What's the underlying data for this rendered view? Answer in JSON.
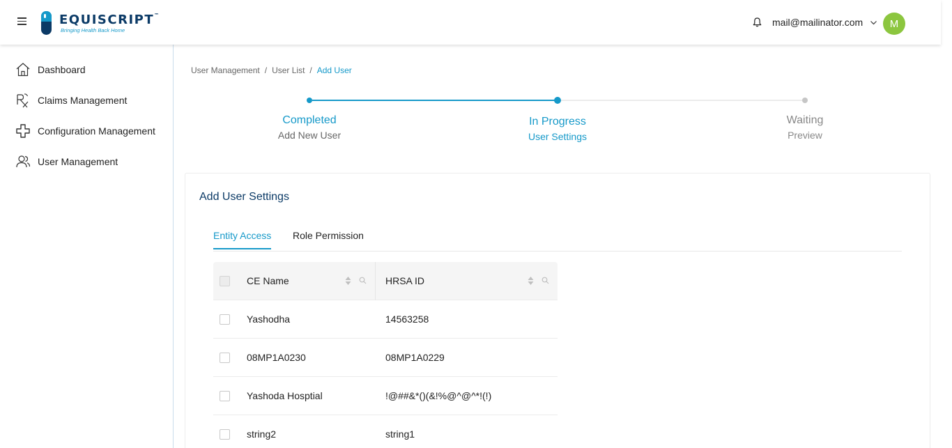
{
  "header": {
    "brand_name": "EQUISCRIPT",
    "brand_tm": "™",
    "brand_tagline": "Bringing Health Back Home",
    "user_email": "mail@mailinator.com",
    "avatar_initial": "M",
    "colors": {
      "brand_blue": "#0b3a66",
      "accent": "#1599c9",
      "avatar_bg": "#8cc63f"
    }
  },
  "sidebar": {
    "items": [
      {
        "label": "Dashboard",
        "icon": "home-icon"
      },
      {
        "label": "Claims Management",
        "icon": "prescription-icon"
      },
      {
        "label": "Configuration Management",
        "icon": "medical-cross-icon"
      },
      {
        "label": "User Management",
        "icon": "users-icon"
      }
    ]
  },
  "breadcrumb": {
    "items": [
      "User Management",
      "User List",
      "Add User"
    ],
    "separator": "/"
  },
  "stepper": {
    "steps": [
      {
        "status": "Completed",
        "label": "Add New User"
      },
      {
        "status": "In Progress",
        "label": "User Settings"
      },
      {
        "status": "Waiting",
        "label": "Preview"
      }
    ],
    "current_step": 2
  },
  "card": {
    "title": "Add User Settings",
    "tabs": [
      {
        "label": "Entity Access",
        "active": true
      },
      {
        "label": "Role Permission",
        "active": false
      }
    ]
  },
  "table": {
    "columns": [
      "CE Name",
      "HRSA ID"
    ],
    "rows": [
      [
        "Yashodha",
        "14563258"
      ],
      [
        "08MP1A0230",
        "08MP1A0229"
      ],
      [
        "Yashoda Hosptial",
        "!@##&*()(&!%@^@^*!(!)"
      ],
      [
        "string2",
        "string1"
      ]
    ]
  }
}
